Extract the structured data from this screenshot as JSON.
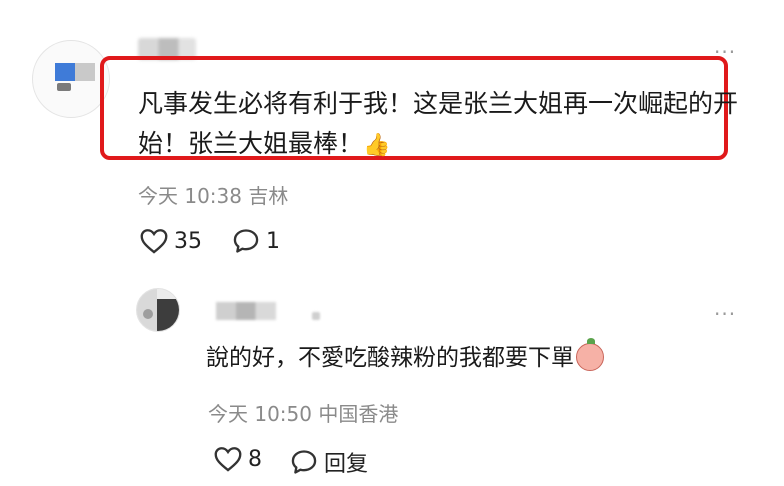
{
  "comment": {
    "text": "凡事发生必将有利于我！这是张兰大姐再一次崛起的开始！张兰大姐最棒！",
    "emoji": "👍",
    "time": "今天 10:38",
    "location": "吉林",
    "likes": "35",
    "replies": "1",
    "more": "···"
  },
  "reply": {
    "text": "說的好，不愛吃酸辣粉的我都要下單",
    "time": "今天 10:50",
    "location": "中国香港",
    "likes": "8",
    "reply_label": "回复",
    "more": "···"
  },
  "colors": {
    "highlight": "#e0191b",
    "meta": "#8a8a8a"
  }
}
